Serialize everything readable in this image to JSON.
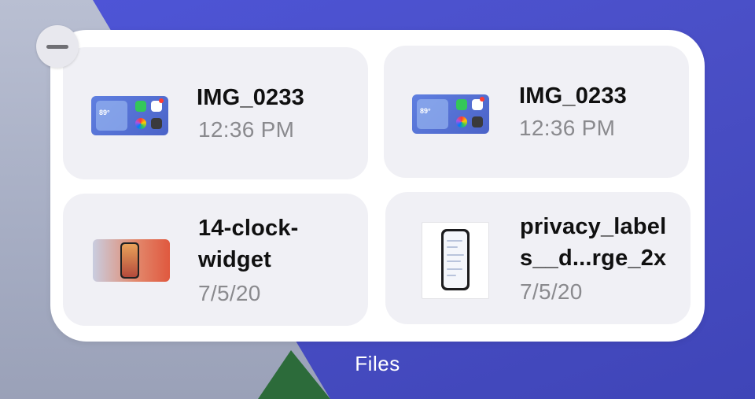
{
  "widget": {
    "label": "Files",
    "remove_icon": "minus-icon",
    "items": [
      {
        "name": "IMG_0233",
        "meta": "12:36 PM",
        "thumb": "home-screen-thumbnail"
      },
      {
        "name": "IMG_0233",
        "meta": "12:36 PM",
        "thumb": "home-screen-thumbnail"
      },
      {
        "name_line1": "14-clock-",
        "name_line2": "widget",
        "meta": "7/5/20",
        "thumb": "clock-widget-thumbnail"
      },
      {
        "name_line1": "privacy_label",
        "name_line2": "s__d...rge_2x",
        "meta": "7/5/20",
        "thumb": "privacy-labels-thumbnail"
      }
    ]
  },
  "colors": {
    "wallpaper_blue": "#4a52c9",
    "wallpaper_gray": "#a7aec4",
    "tile_background": "#f0f0f5",
    "secondary_text": "#8a8a8e"
  }
}
